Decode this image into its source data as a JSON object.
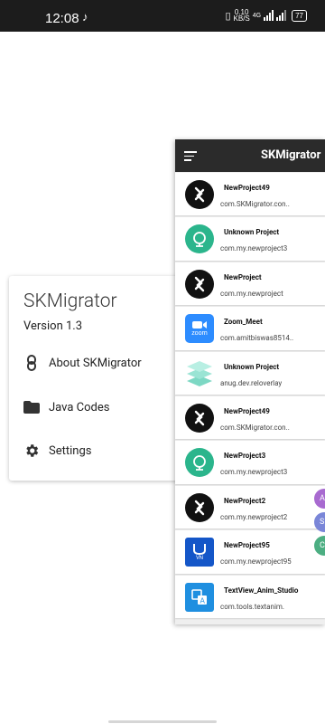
{
  "status_bar": {
    "time": "12:08",
    "speed_value": "0.10",
    "speed_unit": "KB/S",
    "network_label": "4G",
    "battery": "77"
  },
  "drawer": {
    "title": "SKMigrator",
    "version": "Version 1.3",
    "items": [
      {
        "label": "About SKMigrator",
        "icon": "link-icon"
      },
      {
        "label": "Java Codes",
        "icon": "folder-icon"
      },
      {
        "label": "Settings",
        "icon": "gear-icon"
      }
    ]
  },
  "toolbar": {
    "title": "SKMigrator"
  },
  "projects": [
    {
      "name": "NewProject49",
      "package": "com.SKMigrator.con..",
      "icon": "sketchware"
    },
    {
      "name": "Unknown Project",
      "package": "com.my.newproject3",
      "icon": "teal"
    },
    {
      "name": "NewProject",
      "package": "com.my.newproject",
      "icon": "sketchware"
    },
    {
      "name": "Zoom_Meet",
      "package": "com.amitbiswas8514..",
      "icon": "zoom"
    },
    {
      "name": "Unknown Project",
      "package": "anug.dev.reloverlay",
      "icon": "layers"
    },
    {
      "name": "NewProject49",
      "package": "com.SKMigrator.con..",
      "icon": "sketchware"
    },
    {
      "name": "NewProject3",
      "package": "com.my.newproject3",
      "icon": "teal"
    },
    {
      "name": "NewProject2",
      "package": "com.my.newproject2",
      "icon": "sketchware"
    },
    {
      "name": "NewProject95",
      "package": "com.my.newproject95",
      "icon": "vn"
    },
    {
      "name": "TextView_Anim_Studio",
      "package": "com.tools.textanim.",
      "icon": "textanim"
    }
  ],
  "fabs": [
    {
      "label": "A",
      "color": "#a86ad0"
    },
    {
      "label": "S",
      "color": "#7a86d8"
    },
    {
      "label": "C",
      "color": "#4cae82"
    }
  ],
  "icon_labels": {
    "zoom": "zoom",
    "vn": "VN"
  },
  "colors": {
    "toolbar": "#2b2b2b",
    "status_bar": "#1c1c1c",
    "teal": "#2bb58c",
    "zoom_blue": "#2d8cff",
    "vn_blue": "#1456c8"
  }
}
